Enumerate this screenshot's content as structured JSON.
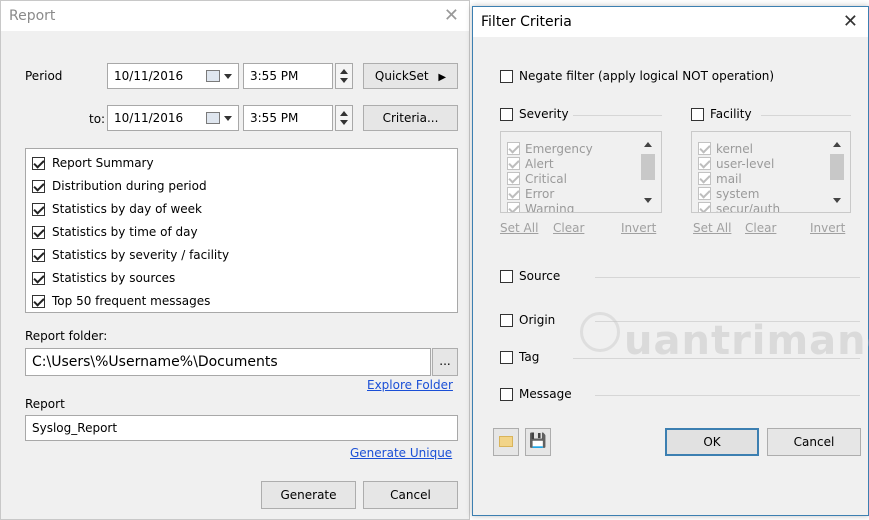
{
  "report": {
    "title": "Report",
    "period_label": "Period",
    "period_from_date": "10/11/2016",
    "period_from_time": "3:55 PM",
    "to_label": "to:",
    "period_to_date": "10/11/2016",
    "period_to_time": "3:55 PM",
    "quickset_label": "QuickSet",
    "criteria_label": "Criteria...",
    "sections": [
      {
        "label": "Report Summary",
        "checked": true
      },
      {
        "label": "Distribution during period",
        "checked": true
      },
      {
        "label": "Statistics by day of week",
        "checked": true
      },
      {
        "label": "Statistics by time of day",
        "checked": true
      },
      {
        "label": "Statistics by severity / facility",
        "checked": true
      },
      {
        "label": "Statistics by sources",
        "checked": true
      },
      {
        "label": "Top 50 frequent messages",
        "checked": true
      }
    ],
    "folder_label": "Report folder:",
    "folder_value": "C:\\Users\\%Username%\\Documents",
    "browse_label": "...",
    "explore_folder_label": "Explore Folder",
    "report_name_label": "Report",
    "report_name_value": "Syslog_Report",
    "generate_unique_label": "Generate Unique",
    "generate_label": "Generate",
    "cancel_label": "Cancel"
  },
  "filter": {
    "title": "Filter Criteria",
    "negate_label": "Negate filter (apply logical NOT operation)",
    "severity_label": "Severity",
    "severity_items": [
      "Emergency",
      "Alert",
      "Critical",
      "Error",
      "Warning"
    ],
    "facility_label": "Facility",
    "facility_items": [
      "kernel",
      "user-level",
      "mail",
      "system",
      "secur/auth"
    ],
    "set_all_label": "Set All",
    "clear_label": "Clear",
    "invert_label": "Invert",
    "source_label": "Source",
    "origin_label": "Origin",
    "tag_label": "Tag",
    "message_label": "Message",
    "ok_label": "OK",
    "cancel_label": "Cancel"
  },
  "watermark_text": "uantrimang",
  "colors": {
    "accent": "#3c7fb1",
    "link": "#1a4fd6",
    "window_bg": "#f0f0f0"
  }
}
